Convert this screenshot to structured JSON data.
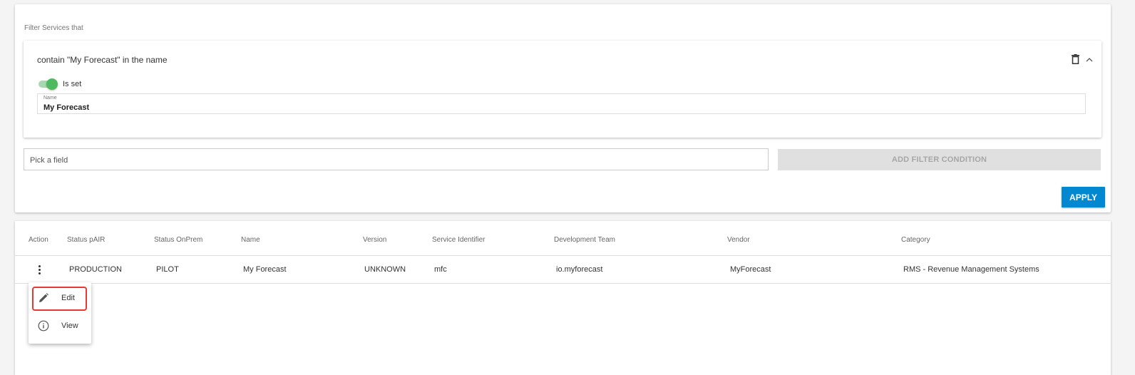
{
  "filter": {
    "heading": "Filter Services that",
    "condition": {
      "title": "contain \"My Forecast\" in the name",
      "toggle_label": "Is set",
      "toggle_on": true,
      "field_label": "Name",
      "field_value": "My Forecast"
    },
    "pick_placeholder": "Pick a field",
    "add_condition_label": "ADD FILTER CONDITION",
    "apply_label": "APPLY"
  },
  "table": {
    "columns": [
      "Action",
      "Status pAIR",
      "Status OnPrem",
      "Name",
      "Version",
      "Service Identifier",
      "Development Team",
      "Vendor",
      "Category"
    ],
    "rows": [
      {
        "status_pair": "PRODUCTION",
        "status_onprem": "PILOT",
        "name": "My Forecast",
        "version": "UNKNOWN",
        "service_identifier": "mfc",
        "development_team": "io.myforecast",
        "vendor": "MyForecast",
        "category": "RMS - Revenue Management Systems"
      }
    ]
  },
  "action_menu": {
    "items": [
      {
        "label": "Edit",
        "icon": "pencil-icon",
        "highlighted": true
      },
      {
        "label": "View",
        "icon": "info-icon",
        "highlighted": false
      }
    ]
  },
  "colors": {
    "accent": "#0288d1",
    "toggle_on": "#4cbb5f",
    "highlight": "#e53935"
  }
}
